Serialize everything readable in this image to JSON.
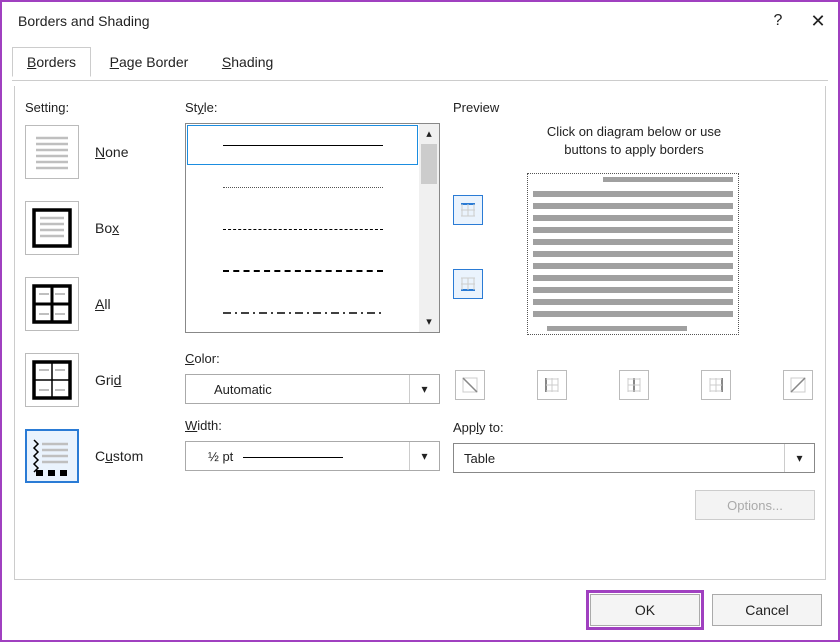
{
  "title": "Borders and Shading",
  "tabs": [
    "Borders",
    "Page Border",
    "Shading"
  ],
  "setting": {
    "label": "Setting:",
    "options": [
      "None",
      "Box",
      "All",
      "Grid",
      "Custom"
    ],
    "selected": "Custom"
  },
  "style": {
    "label": "Style:"
  },
  "color": {
    "label": "Color:",
    "value": "Automatic"
  },
  "width": {
    "label": "Width:",
    "value": "½ pt"
  },
  "preview": {
    "label": "Preview",
    "hint1": "Click on diagram below or use",
    "hint2": "buttons to apply borders"
  },
  "apply_to": {
    "label": "Apply to:",
    "value": "Table"
  },
  "options_button": "Options...",
  "ok": "OK",
  "cancel": "Cancel"
}
